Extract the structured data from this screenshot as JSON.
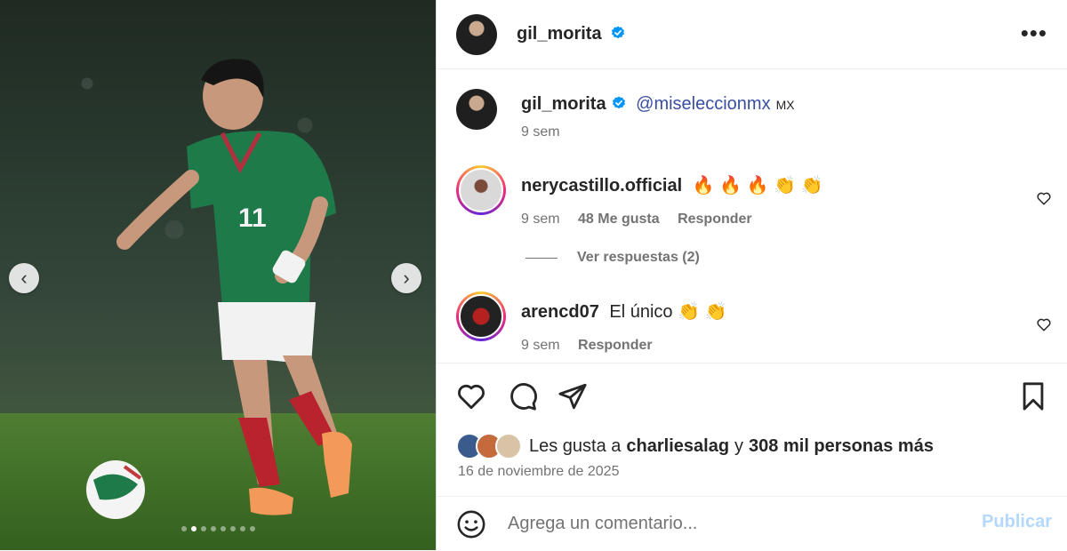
{
  "post": {
    "username": "gil_morita",
    "more_label": "•••"
  },
  "media": {
    "prev_label": "‹",
    "next_label": "›",
    "slide_count": 8,
    "active_slide": 2
  },
  "caption": {
    "username": "gil_morita",
    "mention": "@miseleccionmx",
    "country_code": "MX",
    "time": "9 sem"
  },
  "comments": [
    {
      "username": "nerycastillo.official",
      "text": "🔥 🔥 🔥 👏 👏",
      "time": "9 sem",
      "likes": "48 Me gusta",
      "reply_label": "Responder"
    },
    {
      "username": "arencd07",
      "text": "El único 👏 👏",
      "time": "9 sem",
      "reply_label": "Responder"
    }
  ],
  "view_replies": "Ver respuestas (2)",
  "likes": {
    "prefix": "Les gusta a",
    "user": "charliesalag",
    "connector": "y",
    "others": "308 mil personas más"
  },
  "date": "16 de noviembre de 2025",
  "composer": {
    "placeholder": "Agrega un comentario...",
    "publish_label": "Publicar"
  },
  "colors": {
    "verified": "#0095f6",
    "mention": "#3a4ea1",
    "publish_disabled": "#b3d8fb"
  },
  "icons": [
    "emoji-icon",
    "heart-icon",
    "comment-icon",
    "share-icon",
    "save-icon",
    "verified-icon"
  ]
}
